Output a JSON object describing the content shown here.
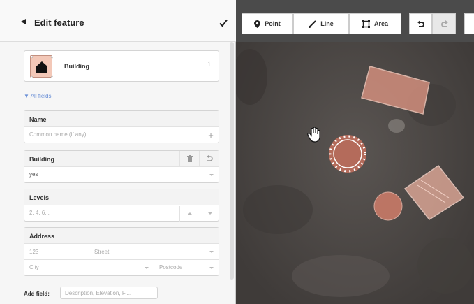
{
  "sidebar": {
    "title": "Edit feature",
    "preset": {
      "name": "Building"
    },
    "all_fields_label": "▼ All fields",
    "fields": [
      {
        "label": "Name",
        "placeholder": "Common name (if any)"
      },
      {
        "label": "Building",
        "value": "yes"
      },
      {
        "label": "Levels",
        "placeholder": "2, 4, 6..."
      },
      {
        "label": "Address",
        "housenumber_placeholder": "123",
        "street_placeholder": "Street",
        "city_placeholder": "City",
        "postcode_placeholder": "Postcode"
      }
    ],
    "add_field": {
      "label": "Add field:",
      "placeholder": "Description, Elevation, Fi..."
    }
  },
  "toolbar": {
    "point_label": "Point",
    "line_label": "Line",
    "area_label": "Area"
  },
  "colors": {
    "feature_fill": "#e4a590",
    "feature_stroke": "#f3d3c8",
    "map_bg": "#4f4a47",
    "link_blue": "#6a8fd6"
  },
  "icons": [
    "back-icon",
    "checkmark-icon",
    "building-icon",
    "info-icon",
    "plus-icon",
    "trash-icon",
    "undo-icon",
    "redo-icon",
    "point-icon",
    "line-icon",
    "area-icon",
    "hand-icon"
  ]
}
